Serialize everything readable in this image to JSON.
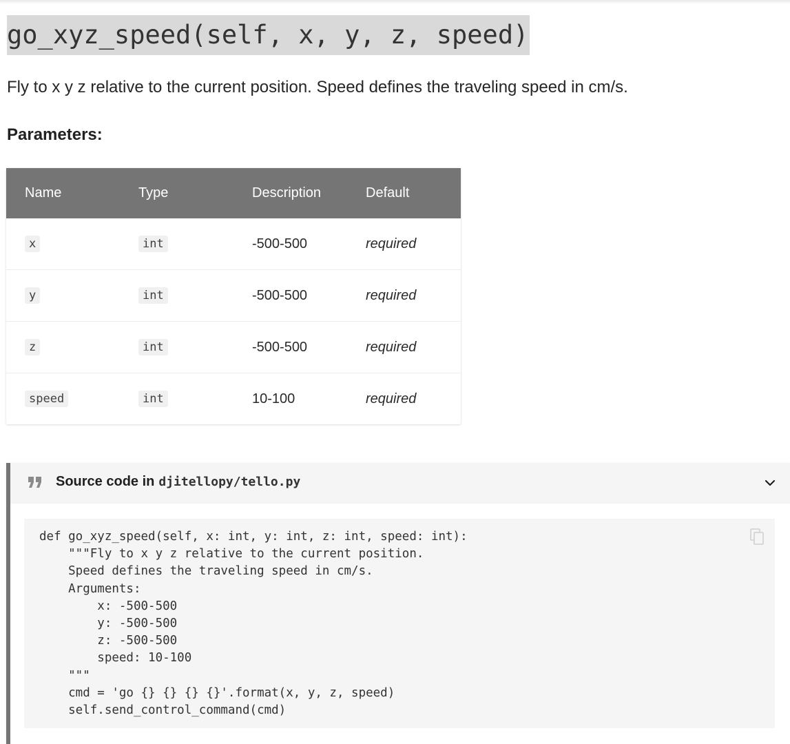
{
  "heading": {
    "signature": "go_xyz_speed(self, x, y, z, speed)"
  },
  "summary": "Fly to x y z relative to the current position. Speed defines the traveling speed in cm/s.",
  "parameters": {
    "heading": "Parameters:",
    "columns": [
      "Name",
      "Type",
      "Description",
      "Default"
    ],
    "rows": [
      {
        "name": "x",
        "type": "int",
        "description": "-500-500",
        "default": "required"
      },
      {
        "name": "y",
        "type": "int",
        "description": "-500-500",
        "default": "required"
      },
      {
        "name": "z",
        "type": "int",
        "description": "-500-500",
        "default": "required"
      },
      {
        "name": "speed",
        "type": "int",
        "description": "10-100",
        "default": "required"
      }
    ]
  },
  "source": {
    "label": "Source code in",
    "path": "djitellopy/tello.py",
    "code": "def go_xyz_speed(self, x: int, y: int, z: int, speed: int):\n    \"\"\"Fly to x y z relative to the current position.\n    Speed defines the traveling speed in cm/s.\n    Arguments:\n        x: -500-500\n        y: -500-500\n        z: -500-500\n        speed: 10-100\n    \"\"\"\n    cmd = 'go {} {} {} {}'.format(x, y, z, speed)\n    self.send_control_command(cmd)"
  },
  "icons": {
    "quote": "quote-icon",
    "expand": "chevron-down-icon",
    "copy": "copy-icon"
  },
  "colors": {
    "table_header": "#757575",
    "heading_highlight": "#d9d9d9",
    "code_background": "#f5f5f5"
  }
}
